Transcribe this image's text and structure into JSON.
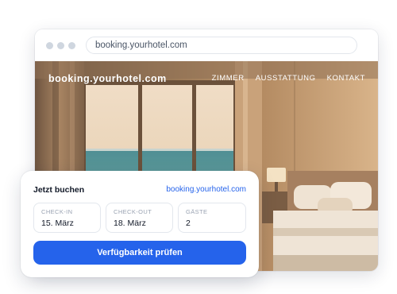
{
  "browser": {
    "url": "booking.yourhotel.com"
  },
  "site": {
    "brand": "booking.yourhotel.com",
    "nav": [
      "ZIMMER",
      "AUSSTATTUNG",
      "KONTAKT"
    ]
  },
  "booking": {
    "title": "Jetzt buchen",
    "link": "booking.yourhotel.com",
    "fields": [
      {
        "label": "CHECK-IN",
        "value": "15. März"
      },
      {
        "label": "CHECK-OUT",
        "value": "18. März"
      },
      {
        "label": "GÄSTE",
        "value": "2"
      }
    ],
    "button": "Verfügbarkeit prüfen"
  },
  "colors": {
    "accent": "#2563eb",
    "hero_warm": "#c9a177",
    "sea": "#4e8d93"
  }
}
